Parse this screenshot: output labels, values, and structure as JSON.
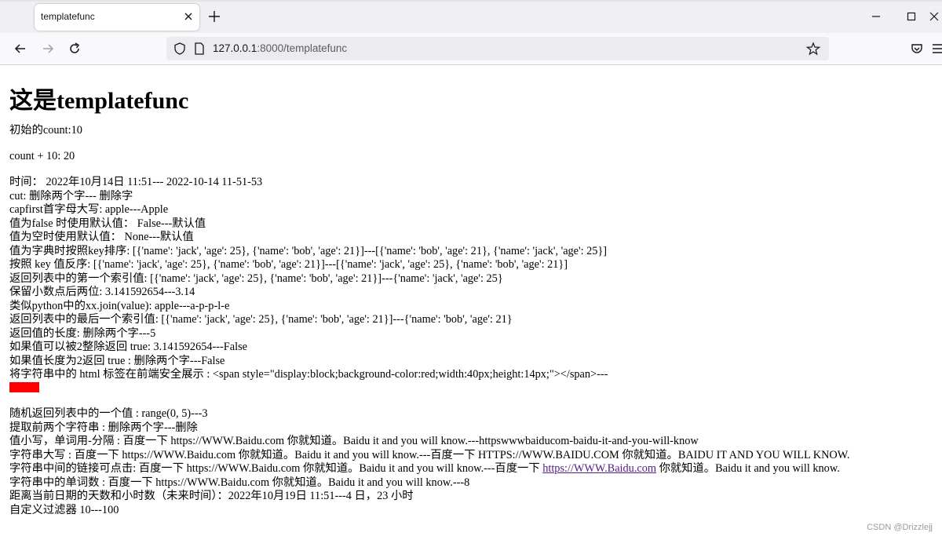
{
  "browser": {
    "tab_title": "templatefunc",
    "url_host": "127.0.0.1",
    "url_rest": ":8000/templatefunc"
  },
  "icons": {
    "back": "back-arrow-icon",
    "forward": "forward-arrow-icon",
    "reload": "reload-icon",
    "shield": "tracking-protection-shield-icon",
    "page": "page-info-icon",
    "bookmark": "bookmark-star-icon",
    "pocket": "pocket-icon",
    "menu": "hamburger-menu-icon"
  },
  "page": {
    "heading_cn": "这是",
    "heading_en": "templatefunc",
    "initial_count": "初始的count:10",
    "count_plus": "count + 10: 20",
    "lines": [
      "时间： 2022年10月14日 11:51--- 2022-10-14 11-51-53",
      "cut:  删除两个字--- 删除字",
      "capfirst首字母大写: apple---Apple",
      "值为false 时使用默认值： False---默认值",
      "值为空时使用默认值： None---默认值",
      "值为字典时按照key排序:  [{'name': 'jack', 'age': 25}, {'name': 'bob', 'age': 21}]---[{'name': 'bob', 'age': 21}, {'name': 'jack', 'age': 25}]",
      "按照 key 值反序:  [{'name': 'jack', 'age': 25}, {'name': 'bob', 'age': 21}]---[{'name': 'jack', 'age': 25}, {'name': 'bob', 'age': 21}]",
      "返回列表中的第一个索引值: [{'name': 'jack', 'age': 25}, {'name': 'bob', 'age': 21}]---{'name': 'jack', 'age': 25}",
      "保留小数点后两位: 3.141592654---3.14",
      "类似python中的xx.join(value):  apple---a-p-p-l-e",
      "返回列表中的最后一个索引值:  [{'name': 'jack', 'age': 25}, {'name': 'bob', 'age': 21}]---{'name': 'bob', 'age': 21}",
      "返回值的长度: 删除两个字---5",
      "如果值可以被2整除返回 true:  3.141592654---False",
      "如果值长度为2返回 true : 删除两个字---False",
      "将字符串中的 html 标签在前端安全展示 : <span style=\"display:block;background-color:red;width:40px;height:14px;\"></span>---"
    ],
    "lines2": [
      "随机返回列表中的一个值 : range(0, 5)---3",
      "提取前两个字符串 : 删除两个字---删除",
      "值小写，单词用-分隔 : 百度一下 https://WWW.Baidu.com 你就知道。Baidu it and you will know.---httpswwwbaiducom-baidu-it-and-you-will-know",
      "字符串大写 : 百度一下 https://WWW.Baidu.com 你就知道。Baidu it and you will know.---百度一下 HTTPS://WWW.BAIDU.COM 你就知道。BAIDU IT AND YOU WILL KNOW."
    ],
    "urlize_prefix": "字符串中间的链接可点击: 百度一下 https://WWW.Baidu.com 你就知道。Baidu it and you will know.---百度一下 ",
    "urlize_link": "https://WWW.Baidu.com",
    "urlize_suffix": " 你就知道。Baidu it and you will know.",
    "lines3": [
      "字符串中的单词数 : 百度一下 https://WWW.Baidu.com 你就知道。Baidu it and you will know.---8",
      "距离当前日期的天数和小时数（未来时间）：2022年10月19日 11:51---4 日，23 小时",
      "自定义过滤器 10---100"
    ],
    "safe_box_color": "#ff0000"
  },
  "watermark": "CSDN @Drizzlejj"
}
